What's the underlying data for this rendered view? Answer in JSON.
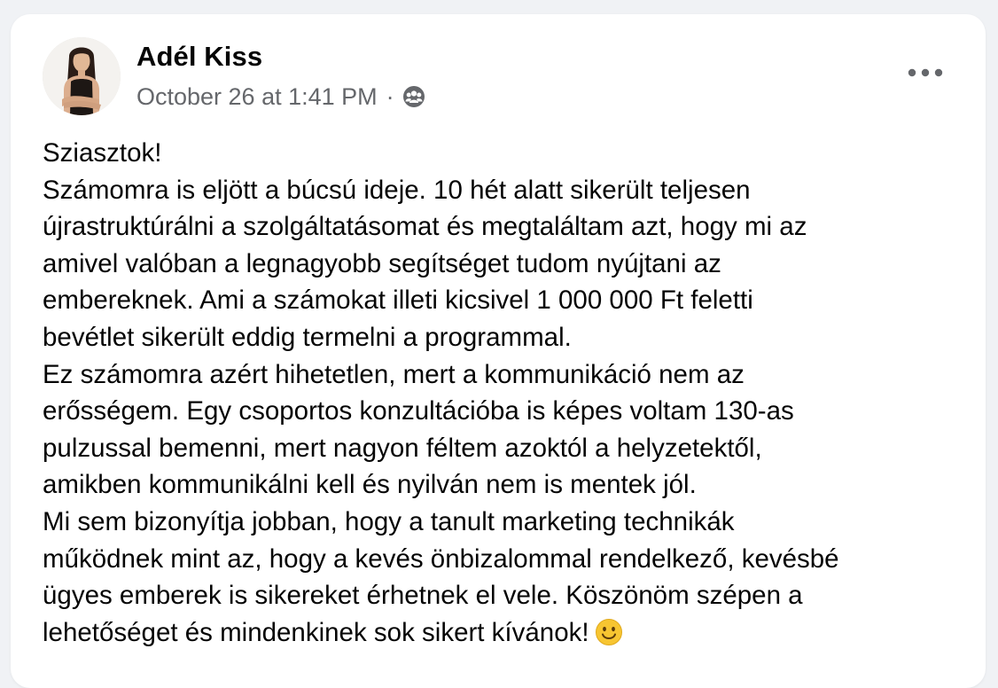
{
  "post": {
    "author_name": "Adél Kiss",
    "timestamp": "October 26 at 1:41 PM",
    "separator": "·",
    "audience_icon": "friends-icon",
    "more_icon": "more-options-icon",
    "avatar_icon": "profile-photo",
    "body_lines": [
      "Sziasztok!",
      "Számomra is eljött a búcsú ideje. 10 hét alatt sikerült teljesen",
      "újrastruktúrálni a szolgáltatásomat és megtaláltam azt, hogy mi az",
      "amivel valóban a legnagyobb segítséget tudom nyújtani az",
      "embereknek. Ami a számokat illeti kicsivel 1 000 000 Ft feletti",
      "bevétlet sikerült eddig termelni a programmal.",
      "Ez számomra azért hihetetlen, mert a kommunikáció nem az",
      "erősségem. Egy csoportos konzultációba is képes voltam 130-as",
      "pulzussal bemenni, mert nagyon féltem azoktól a helyzetektől,",
      "amikben kommunikálni kell és nyilván nem is mentek jól.",
      "Mi sem bizonyítja jobban, hogy a tanult marketing technikák",
      "működnek mint az, hogy a kevés önbizalommal rendelkező, kevésbé",
      "ügyes emberek is sikereket érhetnek el vele. Köszönöm szépen a",
      "lehetőséget és mindenkinek sok sikert kívánok!"
    ],
    "trailing_emoji": "smile-emoji-icon"
  },
  "colors": {
    "page_background": "#f0f2f5",
    "card_background": "#ffffff",
    "primary_text": "#050505",
    "secondary_text": "#65676b",
    "emoji_yellow": "#f7c531"
  }
}
